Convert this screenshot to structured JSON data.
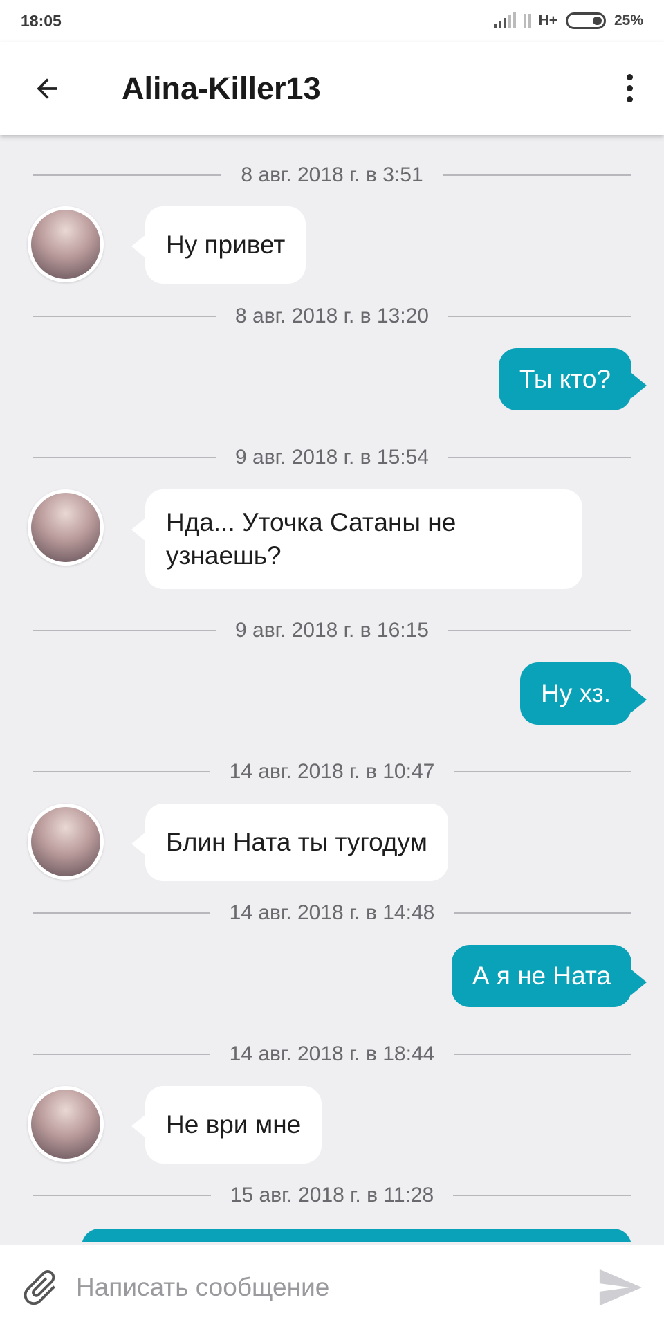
{
  "status_bar": {
    "time": "18:05",
    "network": "H+",
    "battery": "25%",
    "battery_level": 0.25
  },
  "header": {
    "title": "Alina-Killer13",
    "back_icon": "arrow-left-icon",
    "menu_icon": "more-vertical-icon"
  },
  "messages": [
    {
      "date": "8 авг. 2018 г. в 3:51",
      "direction": "in",
      "text": "Ну привет"
    },
    {
      "date": "8 авг. 2018 г. в 13:20",
      "direction": "out",
      "text": "Ты кто?"
    },
    {
      "date": "9 авг. 2018 г. в 15:54",
      "direction": "in",
      "text": "Нда... Уточка Сатаны не узнаешь?"
    },
    {
      "date": "9 авг. 2018 г. в 16:15",
      "direction": "out",
      "text": "Ну хз."
    },
    {
      "date": "14 авг. 2018 г. в 10:47",
      "direction": "in",
      "text": "Блин Ната ты тугодум"
    },
    {
      "date": "14 авг. 2018 г. в 14:48",
      "direction": "out",
      "text": "А я не Ната"
    },
    {
      "date": "14 авг. 2018 г. в 18:44",
      "direction": "in",
      "text": "Не ври мне"
    },
    {
      "date": "15 авг. 2018 г. в 11:28",
      "direction": "out",
      "text": ""
    }
  ],
  "composer": {
    "placeholder": "Написать сообщение",
    "attach_icon": "paperclip-icon",
    "send_icon": "send-icon"
  },
  "colors": {
    "background": "#efeef1",
    "outgoing_bubble": "#0aa2b8",
    "incoming_bubble": "#ffffff"
  }
}
